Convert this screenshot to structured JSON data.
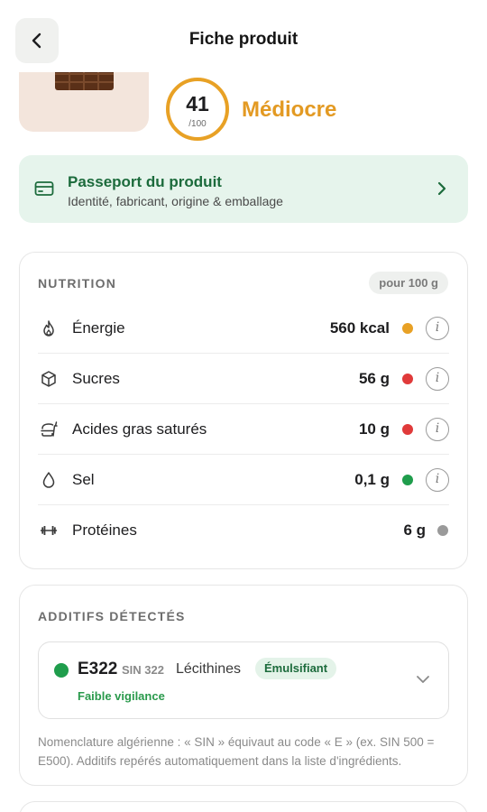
{
  "header": {
    "title": "Fiche produit",
    "back_icon": "chevron-left-icon"
  },
  "product": {
    "score": "41",
    "score_max": "/100",
    "score_label": "Médiocre",
    "score_color": "#e8a125"
  },
  "passport": {
    "title": "Passeport du produit",
    "subtitle": "Identité, fabricant, origine & emballage",
    "icon": "card-icon",
    "accent": "#1c6b3c",
    "background": "#e6f4ec"
  },
  "nutrition": {
    "heading": "NUTRITION",
    "per": "pour 100 g",
    "rows": [
      {
        "label": "Énergie",
        "value": "560 kcal",
        "status": "orange",
        "color": "#e8a125",
        "icon": "flame-icon",
        "info": "i"
      },
      {
        "label": "Sucres",
        "value": "56 g",
        "status": "red",
        "color": "#e03a3a",
        "icon": "cube-icon",
        "info": "i"
      },
      {
        "label": "Acides gras saturés",
        "value": "10 g",
        "status": "red",
        "color": "#e03a3a",
        "icon": "burger-icon",
        "info": "i"
      },
      {
        "label": "Sel",
        "value": "0,1 g",
        "status": "green",
        "color": "#1f9d4c",
        "icon": "drop-icon",
        "info": "i"
      },
      {
        "label": "Protéines",
        "value": "6 g",
        "status": "grey",
        "color": "#9a9a9a",
        "icon": "dumbbell-icon"
      }
    ]
  },
  "additives": {
    "heading": "ADDITIFS DÉTECTÉS",
    "items": [
      {
        "code": "E322",
        "sin": "SIN 322",
        "name": "Lécithines",
        "tag": "Émulsifiant",
        "vigilance": "Faible vigilance",
        "color": "#1f9d4c"
      }
    ],
    "note": "Nomenclature algérienne : « SIN » équivaut au code « E » (ex. SIN 500 = E500). Additifs repérés automatiquement dans la liste d'ingrédients."
  }
}
